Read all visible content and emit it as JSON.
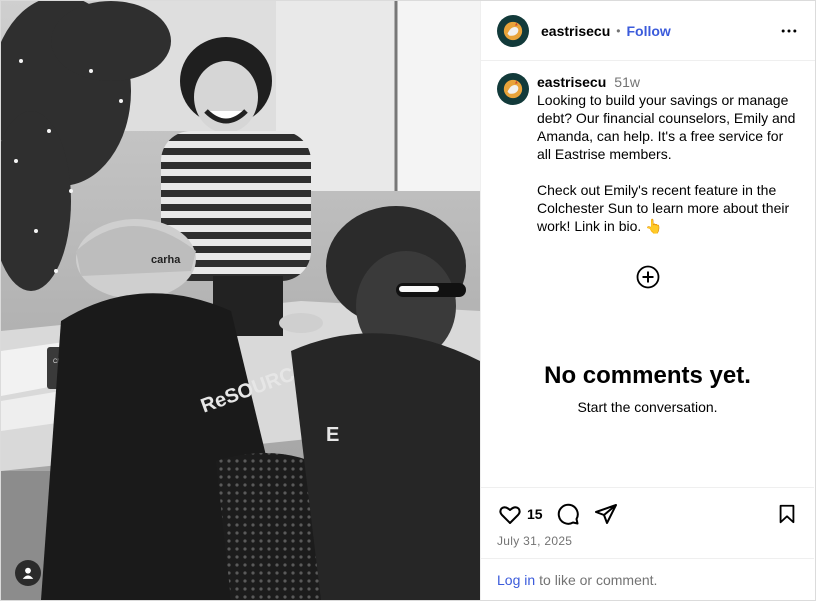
{
  "post": {
    "username": "eastrisecu",
    "separator": "•",
    "follow_label": "Follow",
    "time_ago": "51w",
    "caption": "Looking to build your savings or manage debt? Our financial counselors, Emily and Amanda, can help. It's a free service for all Eastrise members.\n\nCheck out Emily's recent feature in the Colchester Sun to learn more about their work! Link in bio. 👆",
    "like_count": "15",
    "date": "July 31, 2025"
  },
  "photo": {
    "hat_text": "carha",
    "hoodie_text": "ReSOURC",
    "mug_text": "CREATE"
  },
  "comments": {
    "empty_title": "No comments yet.",
    "empty_sub": "Start the conversation."
  },
  "footer": {
    "login_label": "Log in",
    "login_suffix": "to like or comment."
  },
  "icons": {
    "avatar": "rooster-logo-icon",
    "more": "more-horizontal-icon",
    "add_comment": "plus-circle-icon",
    "like": "heart-icon",
    "comment": "comment-icon",
    "share": "share-icon",
    "save": "bookmark-icon",
    "tagged": "user-icon"
  },
  "colors": {
    "link": "#3b5bdb",
    "muted": "#737373",
    "avatar_bg": "#123a3a"
  }
}
